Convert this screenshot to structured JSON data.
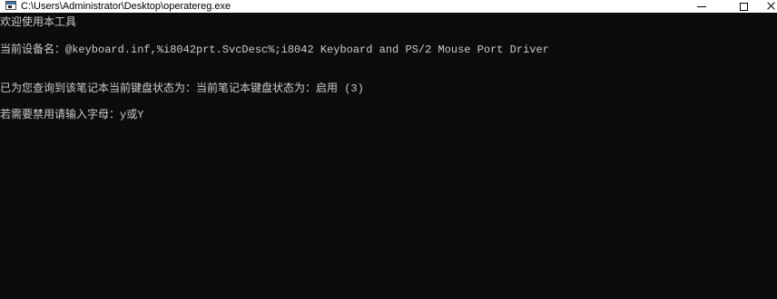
{
  "window": {
    "title": "C:\\Users\\Administrator\\Desktop\\operatereg.exe",
    "icon": "console-app-icon"
  },
  "console": {
    "lines": [
      "欢迎使用本工具",
      "当前设备名：@keyboard.inf,%i8042prt.SvcDesc%;i8042 Keyboard and PS/2 Mouse Port Driver",
      "",
      "已为您查询到该笔记本当前键盘状态为：当前笔记本键盘状态为：启用 (3)",
      "若需要禁用请输入字母：y或Y"
    ]
  },
  "colors": {
    "background": "#0c0c0c",
    "text": "#cccccc",
    "titlebar": "#ffffff"
  }
}
